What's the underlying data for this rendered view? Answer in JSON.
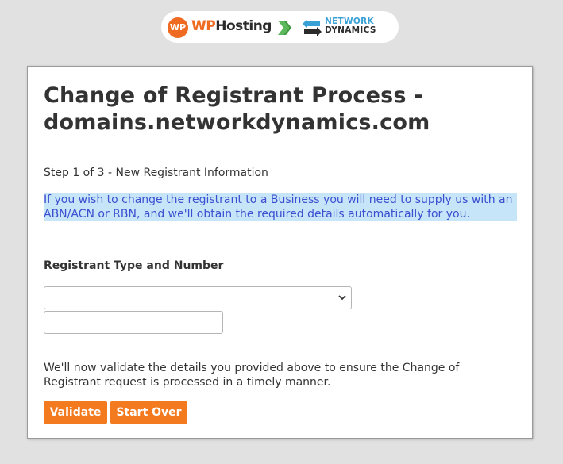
{
  "header": {
    "brand_left": {
      "icon_text": "WP",
      "name_accent": "WP",
      "name_rest": "Hosting"
    },
    "brand_right": {
      "line1": "NETWORK",
      "line2": "DYNAMICS"
    },
    "icons": [
      "wp-hosting-logo-icon",
      "chevron-right-icon",
      "network-dynamics-arrows-icon"
    ],
    "colors": {
      "wp_orange": "#f06b22",
      "nd_blue": "#3aa1d6",
      "chevron_green": "#5cb85c"
    }
  },
  "form": {
    "title": "Change of Registrant Process - domains.networkdynamics.com",
    "step": "Step 1 of 3 - New Registrant Information",
    "info": "If you wish to change the registrant to a Business you will need to supply us with an ABN/ACN or RBN, and we'll obtain the required details automatically for you.",
    "section_label": "Registrant Type and Number",
    "type_select": {
      "selected": ""
    },
    "number_input": {
      "value": "",
      "placeholder": ""
    },
    "validate_note": "We'll now validate the details you provided above to ensure the Change of Registrant request is processed in a timely manner.",
    "buttons": {
      "validate": "Validate",
      "start_over": "Start Over"
    },
    "colors": {
      "button": "#f47a1f",
      "info_bg": "#c6e5f8",
      "info_text": "#3b4fd0"
    }
  }
}
